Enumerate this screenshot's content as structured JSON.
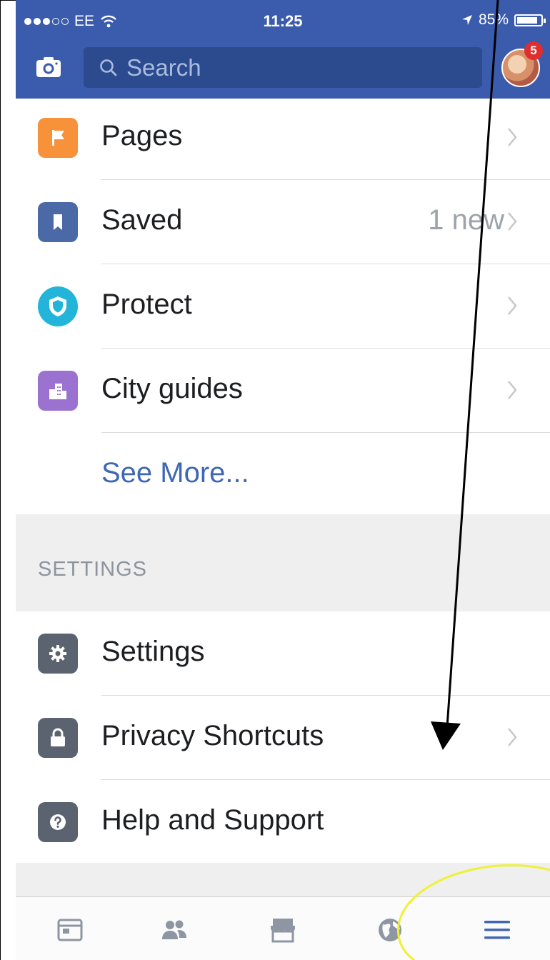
{
  "status_bar": {
    "carrier": "EE",
    "time": "11:25",
    "battery": "85%"
  },
  "header": {
    "search_placeholder": "Search",
    "notification_count": "5"
  },
  "menu_items": [
    {
      "label": "Pages",
      "extra": ""
    },
    {
      "label": "Saved",
      "extra": "1 new"
    },
    {
      "label": "Protect",
      "extra": ""
    },
    {
      "label": "City guides",
      "extra": ""
    }
  ],
  "see_more": "See More...",
  "settings": {
    "header": "SETTINGS",
    "items": [
      {
        "label": "Settings"
      },
      {
        "label": "Privacy Shortcuts"
      },
      {
        "label": "Help and Support"
      }
    ]
  },
  "colors": {
    "header_blue": "#3b5cad",
    "pages_orange": "#f7923a",
    "saved_blue": "#4a69a6",
    "protect_cyan": "#23b5d9",
    "city_purple": "#9b72cf",
    "settings_gray": "#5b6370",
    "link_blue": "#3e67b5",
    "annotation_yellow": "#f0f036"
  },
  "icons": {
    "pages": "flag-icon",
    "saved": "bookmark-icon",
    "protect": "shield-icon",
    "city_guides": "buildings-icon",
    "settings": "gear-icon",
    "privacy": "lock-icon",
    "help": "question-icon",
    "tabs": [
      "news-feed-icon",
      "friends-icon",
      "marketplace-icon",
      "notifications-globe-icon",
      "menu-icon"
    ]
  }
}
